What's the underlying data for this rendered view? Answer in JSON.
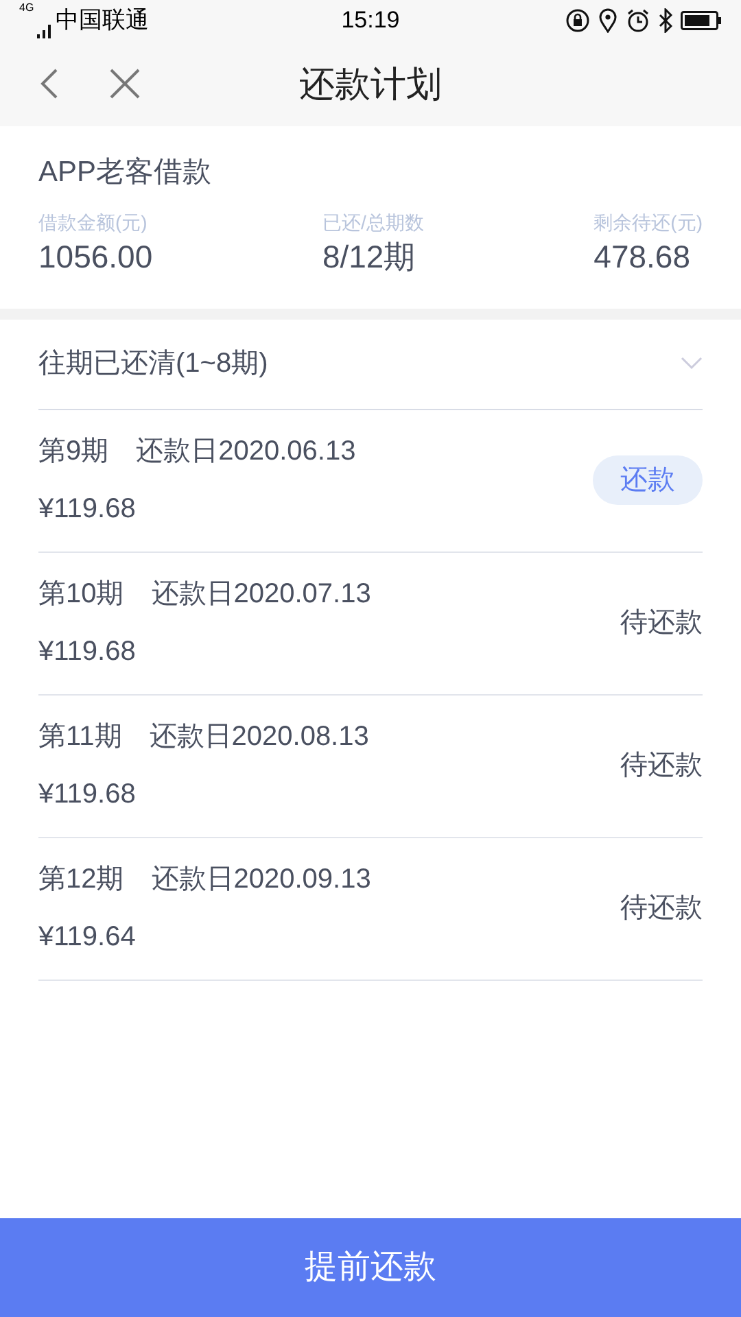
{
  "status_bar": {
    "network": "4G",
    "carrier": "中国联通",
    "time": "15:19"
  },
  "header": {
    "title": "还款计划"
  },
  "loan": {
    "name": "APP老客借款",
    "stats": [
      {
        "label": "借款金额(元)",
        "value": "1056.00"
      },
      {
        "label": "已还/总期数",
        "value": "8/12期"
      },
      {
        "label": "剩余待还(元)",
        "value": "478.68"
      }
    ]
  },
  "paid_section": {
    "label": "往期已还清(1~8期)",
    "expanded": false
  },
  "installments": [
    {
      "period": "第9期",
      "due": "还款日2020.06.13",
      "amount": "¥119.68",
      "kind": "button",
      "action": "还款"
    },
    {
      "period": "第10期",
      "due": "还款日2020.07.13",
      "amount": "¥119.68",
      "kind": "status",
      "action": "待还款"
    },
    {
      "period": "第11期",
      "due": "还款日2020.08.13",
      "amount": "¥119.68",
      "kind": "status",
      "action": "待还款"
    },
    {
      "period": "第12期",
      "due": "还款日2020.09.13",
      "amount": "¥119.64",
      "kind": "status",
      "action": "待还款"
    }
  ],
  "footer_button": "提前还款"
}
